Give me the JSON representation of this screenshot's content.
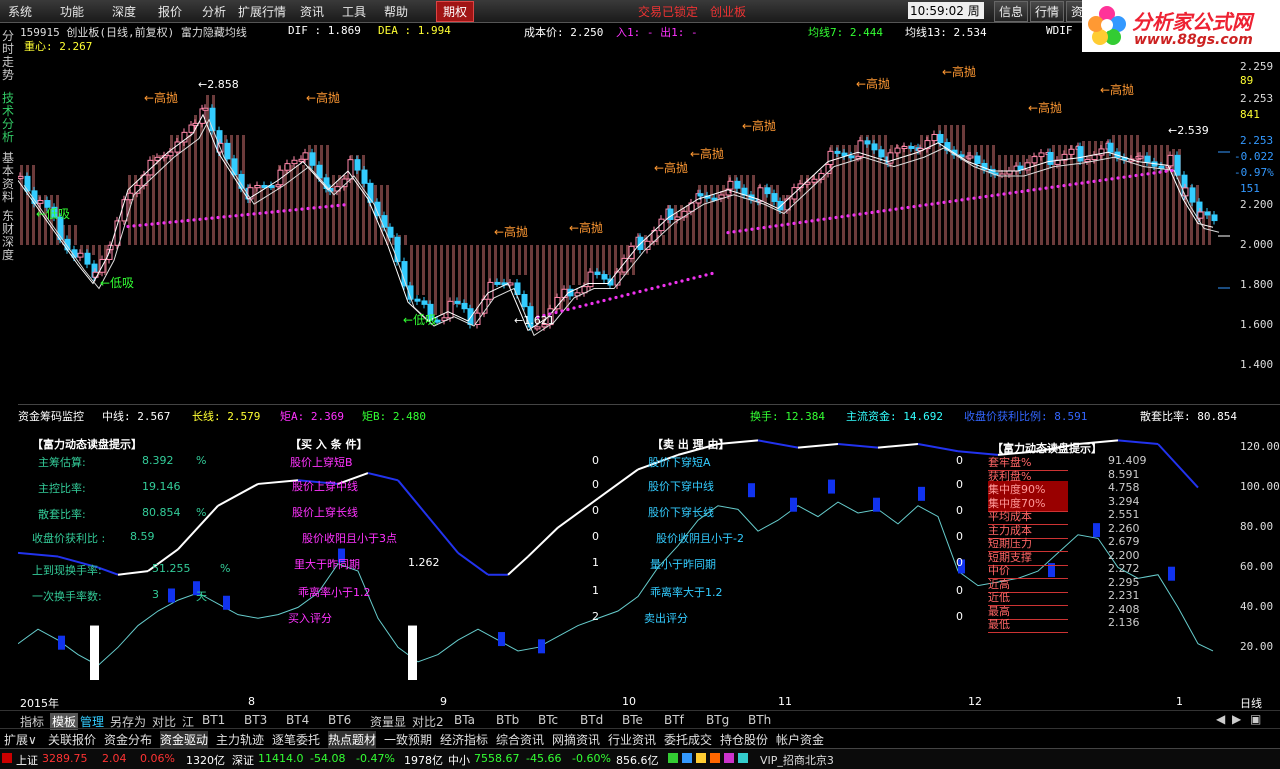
{
  "menu": [
    "系统",
    "功能",
    "深度",
    "报价",
    "分析",
    "扩展行情",
    "资讯",
    "工具",
    "帮助"
  ],
  "menu_active": "期权",
  "notice": [
    "交易已锁定",
    "创业板"
  ],
  "clock": "10:59:02",
  "weekday": "周三",
  "top_buttons": [
    "信息",
    "行情",
    "资"
  ],
  "logo": {
    "name": "分析家公式网",
    "url": "www.88gs.com"
  },
  "side_tabs": [
    "分时走势",
    "技术分析",
    "基本资料",
    "东财深度"
  ],
  "header": {
    "title": "159915 创业板(日线,前复权) 富力隐藏均线",
    "dif": "DIF : 1.869",
    "dea": "DEA : 1.994",
    "cost": "成本价: 2.250",
    "in_out": "入1: - 出1: -",
    "ma7": "均线7: 2.444",
    "ma13": "均线13: 2.534",
    "wdif": "WDIF",
    "center": "重心: 2.267"
  },
  "price_axis": [
    "2.259",
    "2.253",
    "2.200",
    "2.000",
    "1.800",
    "1.600",
    "1.400"
  ],
  "price_side": [
    "89",
    "841",
    "2.253",
    "-0.022",
    "-0.97%",
    "151"
  ],
  "annotations": {
    "high_sell": "←高抛",
    "low_buy": "←低吸",
    "peak": "2.858",
    "trough": "1.621",
    "last": "2.539"
  },
  "mid_header": {
    "title": "资金筹码监控",
    "mid": "中线: 2.567",
    "long": "长线: 2.579",
    "ju_a": "矩A: 2.369",
    "ju_b": "矩B: 2.480",
    "turnover": "换手: 12.384",
    "main_fund": "主流资金: 14.692",
    "profit_ratio": "收盘价获利比例: 8.591",
    "trapped": "散套比率: 80.854"
  },
  "panel_left": {
    "title": "【富力动态读盘提示】",
    "rows": [
      {
        "k": "主筹估算:",
        "v": "8.392",
        "u": "%"
      },
      {
        "k": "主控比率:",
        "v": "19.146",
        "u": ""
      },
      {
        "k": "散套比率:",
        "v": "80.854",
        "u": "%"
      },
      {
        "k": "收盘价获利比 :",
        "v": "8.59",
        "u": ""
      },
      {
        "k": "上到现换手率:",
        "v": "51.255",
        "u": "%"
      },
      {
        "k": "一次换手率数:",
        "v": "3",
        "u": "天"
      }
    ]
  },
  "panel_buy": {
    "title": "【买 入 条 件】",
    "rows": [
      {
        "k": "股价上穿短B",
        "v": "0"
      },
      {
        "k": "股价上穿中线",
        "v": "0"
      },
      {
        "k": "股价上穿长线",
        "v": "0"
      },
      {
        "k": "股价收阳且小于3点",
        "v": "0"
      },
      {
        "k": "里大于昨同期",
        "v": "1"
      },
      {
        "k": "乖离率小于1.2",
        "v": "1"
      },
      {
        "k": "买入评分",
        "v": "2"
      }
    ],
    "extra": "1.262"
  },
  "panel_sell": {
    "title": "【卖 出 理 由】",
    "rows": [
      {
        "k": "股价下穿短A",
        "v": "0"
      },
      {
        "k": "股价下穿中线",
        "v": "0"
      },
      {
        "k": "股价下穿长线",
        "v": "0"
      },
      {
        "k": "股价收阴且小于-2",
        "v": "0"
      },
      {
        "k": "量小于昨同期",
        "v": "0"
      },
      {
        "k": "乖离率大于1.2",
        "v": "0"
      },
      {
        "k": "卖出评分",
        "v": "0"
      }
    ]
  },
  "panel_right": {
    "title": "【富力动态读盘提示】",
    "rows": [
      {
        "k": "套牢盘%",
        "v": "91.409"
      },
      {
        "k": "获利盘%",
        "v": "8.591"
      },
      {
        "k": "集中度90%",
        "v": "4.758"
      },
      {
        "k": "集中度70%",
        "v": "3.294"
      },
      {
        "k": "平均成本",
        "v": "2.551"
      },
      {
        "k": "主力成本",
        "v": "2.260"
      },
      {
        "k": "短期压力",
        "v": "2.679"
      },
      {
        "k": "短期支撑",
        "v": "2.200"
      },
      {
        "k": "中价",
        "v": "2.272"
      },
      {
        "k": "近高",
        "v": "2.295"
      },
      {
        "k": "近低",
        "v": "2.231"
      },
      {
        "k": "最高",
        "v": "2.408"
      },
      {
        "k": "最低",
        "v": "2.136"
      }
    ]
  },
  "lower_axis": [
    "120.00",
    "100.00",
    "80.00",
    "60.00",
    "40.00",
    "20.00"
  ],
  "date_axis": [
    "2015年",
    "8",
    "9",
    "10",
    "11",
    "12",
    "1"
  ],
  "period": "日线",
  "tabs": [
    "指标",
    "模板",
    "管理",
    "另存为",
    "对比",
    "江",
    "BT1",
    "BT3",
    "BT4",
    "BT6",
    "资量显",
    "对比2",
    "BTa",
    "BTb",
    "BTc",
    "BTd",
    "BTe",
    "BTf",
    "BTg",
    "BTh"
  ],
  "functions": [
    "扩展∨",
    "关联报价",
    "资金分布",
    "资金驱动",
    "主力轨迹",
    "逐笔委托",
    "热点题材",
    "一致预期",
    "经济指标",
    "综合资讯",
    "网摘资讯",
    "行业资讯",
    "委托成交",
    "持仓股份",
    "帐户资金"
  ],
  "status": {
    "sh": "上证",
    "sh_val": "3289.75",
    "sh_chg": "2.04",
    "sh_pct": "0.06%",
    "sh_amt": "1320亿",
    "sz": "深证",
    "sz_val": "11414.0",
    "sz_chg": "-54.08",
    "sz_pct": "-0.47%",
    "sz_amt": "1978亿",
    "zx": "中小",
    "zx_val": "7558.67",
    "zx_chg": "-45.66",
    "zx_pct": "-0.60%",
    "zx_amt": "856.6亿",
    "vip": "VIP_招商北京3"
  }
}
